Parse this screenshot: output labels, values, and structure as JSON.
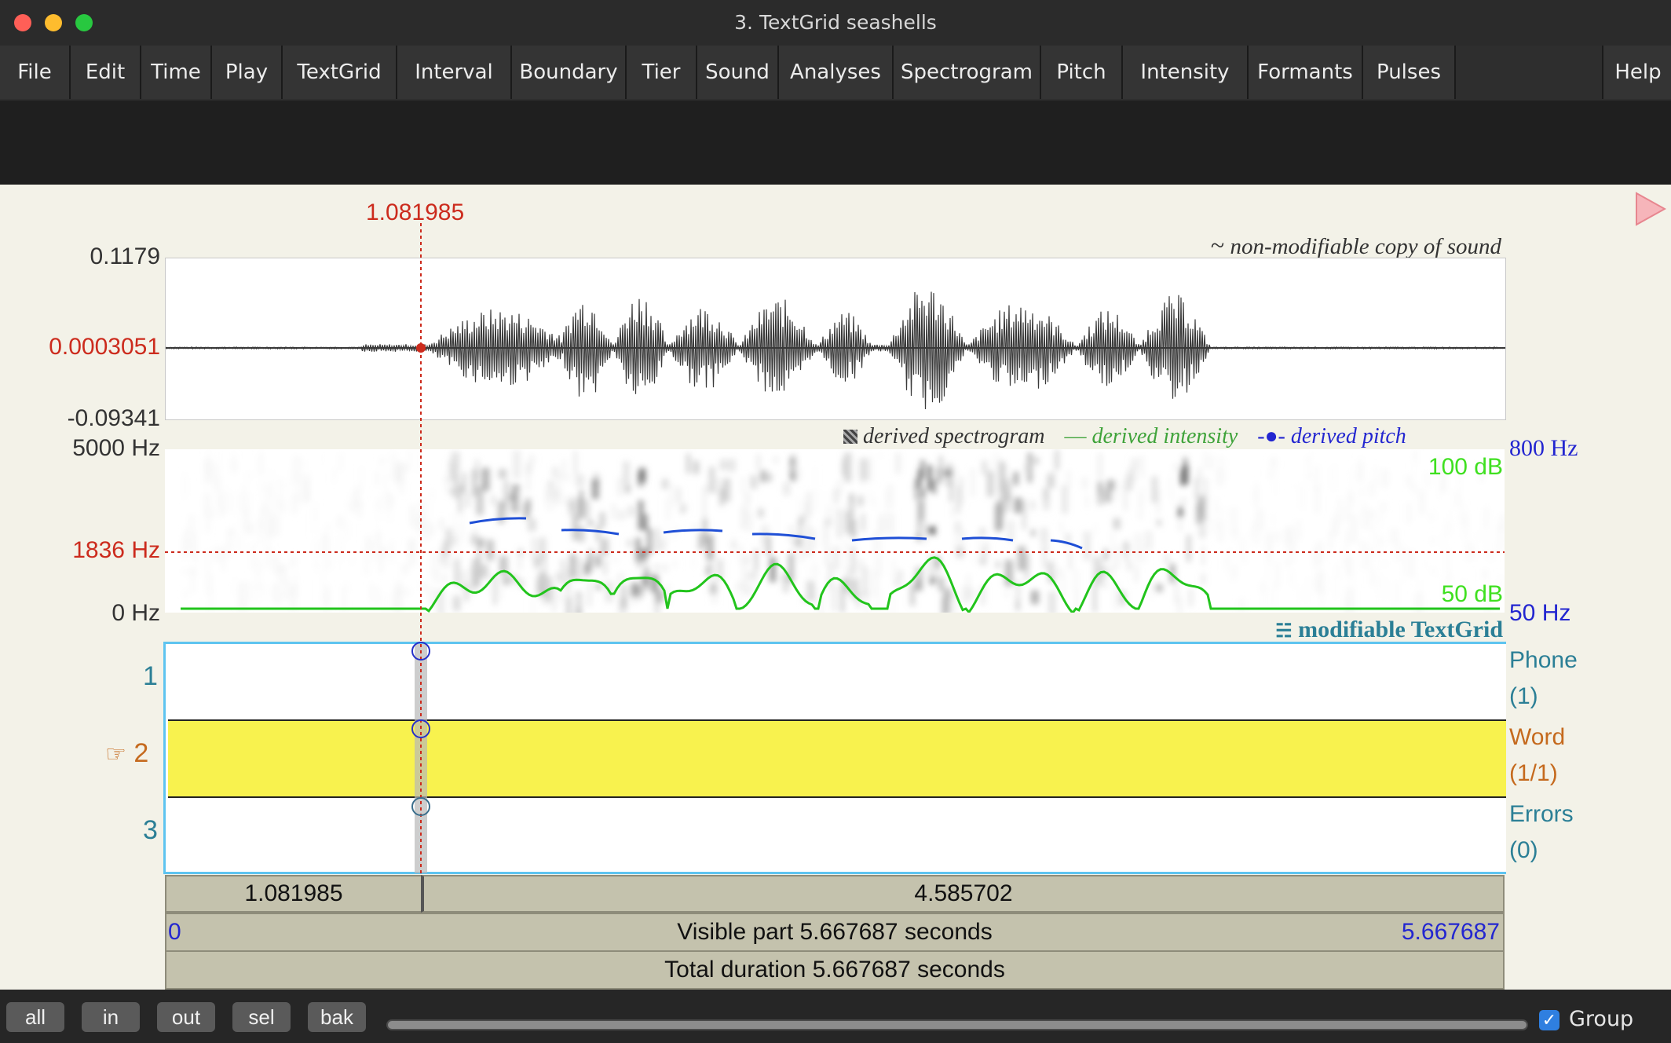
{
  "window": {
    "title": "3. TextGrid seashells",
    "traffic_lights": {
      "close": "#ff5f57",
      "minimize": "#febc2e",
      "zoom": "#28c840"
    }
  },
  "menu": {
    "items": [
      "File",
      "Edit",
      "Time",
      "Play",
      "TextGrid",
      "Interval",
      "Boundary",
      "Tier",
      "Sound",
      "Analyses",
      "Spectrogram",
      "Pitch",
      "Intensity",
      "Formants",
      "Pulses"
    ],
    "help": "Help"
  },
  "cursor": {
    "time_label": "1.081985",
    "color": "#cc2b1d"
  },
  "waveform": {
    "label": "non-modifiable copy of sound",
    "label_icon": "~",
    "y_max": "0.1179",
    "y_cursor": "0.0003051",
    "y_min": "-0.09341"
  },
  "spectrogram": {
    "legend_spec": "derived spectrogram",
    "legend_intensity": "derived intensity",
    "legend_pitch": "derived pitch",
    "freq_max": "5000 Hz",
    "freq_cursor": "1836 Hz",
    "freq_min": "0 Hz",
    "pitch_max": "800 Hz",
    "pitch_min": "50 Hz",
    "intensity_max": "100 dB",
    "intensity_min": "50 dB",
    "colors": {
      "intensity": "#22c41c",
      "pitch": "#1f4fd6",
      "intensity_label": "#3fe020",
      "pitch_label": "#2326d0"
    }
  },
  "textgrid": {
    "label": "modifiable TextGrid",
    "tiers": [
      {
        "number": "1",
        "name": "Phone",
        "count": "(1)",
        "selected": false
      },
      {
        "number": "2",
        "name": "Word",
        "count": "(1/1)",
        "selected": true,
        "pointer_icon": "☞"
      },
      {
        "number": "3",
        "name": "Errors",
        "count": "(0)",
        "selected": false
      }
    ],
    "colors": {
      "selected_tier": "#f8f24e",
      "border": "#5ec4f0"
    }
  },
  "time_bars": {
    "left_segment": "1.081985",
    "right_segment": "4.585702",
    "visible_start": "0",
    "visible_text": "Visible part 5.667687 seconds",
    "visible_end": "5.667687",
    "total_text": "Total duration 5.667687 seconds"
  },
  "bottom": {
    "buttons": [
      "all",
      "in",
      "out",
      "sel",
      "bak"
    ],
    "group_label": "Group",
    "group_checked": true
  }
}
